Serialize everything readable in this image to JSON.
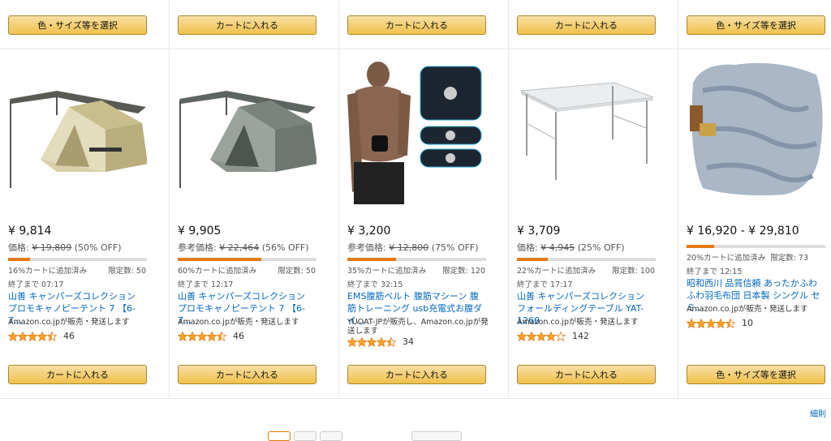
{
  "products": [
    {
      "top_button": "色・サイズ等を選択",
      "price": "¥ 9,814",
      "ref_label": "価格:",
      "ref_price": "¥ 19,809",
      "discount": "(50% OFF)",
      "claimed": "16%カートに追加済み",
      "claimed_pct": 16,
      "limit": "限定数: 50",
      "ends": "終了まで 07:17",
      "title": "山善 キャンパーズコレクション プロモキャノピーテント 7 【6-7...",
      "seller": "Amazon.co.jpが販売・発送します",
      "stars": 4.5,
      "reviews": "46",
      "bottom_button": "カートに入れる",
      "image": "tent-beige-icon"
    },
    {
      "top_button": "カートに入れる",
      "price": "¥ 9,905",
      "ref_label": "参考価格:",
      "ref_price": "¥ 22,464",
      "discount": "(56% OFF)",
      "claimed": "60%カートに追加済み",
      "claimed_pct": 60,
      "limit": "限定数: 50",
      "ends": "終了まで 12:17",
      "title": "山善 キャンパーズコレクション プロモキャノピーテント 7 【6-7...",
      "seller": "Amazon.co.jpが販売・発送します",
      "stars": 4.5,
      "reviews": "46",
      "bottom_button": "カートに入れる",
      "image": "tent-green-icon"
    },
    {
      "top_button": "カートに入れる",
      "price": "¥ 3,200",
      "ref_label": "参考価格:",
      "ref_price": "¥ 12,800",
      "discount": "(75% OFF)",
      "claimed": "35%カートに追加済み",
      "claimed_pct": 35,
      "limit": "限定数: 120",
      "ends": "終了まで 32:15",
      "title": "EMS腹筋ベルト 腹筋マシーン 腹筋トレーニング usb充電式お腹ダイ...",
      "seller": "YUOAT-JPが販売し、Amazon.co.jpが発送します",
      "stars": 4.5,
      "reviews": "34",
      "bottom_button": "カートに入れる",
      "image": "ems-belt-icon"
    },
    {
      "top_button": "カートに入れる",
      "price": "¥ 3,709",
      "ref_label": "価格:",
      "ref_price": "¥ 4,945",
      "discount": "(25% OFF)",
      "claimed": "22%カートに追加済み",
      "claimed_pct": 22,
      "limit": "限定数: 100",
      "ends": "終了まで 17:17",
      "title": "山善 キャンパーズコレクション フォールディングテーブル YAT-1260",
      "seller": "Amazon.co.jpが販売・発送します",
      "stars": 4,
      "reviews": "142",
      "bottom_button": "カートに入れる",
      "image": "folding-table-icon"
    },
    {
      "top_button": "色・サイズ等を選択",
      "price": "¥ 16,920 - ¥ 29,810",
      "claimed": "20%カートに追加済み",
      "claimed_pct": 20,
      "limit": "限定数: 73",
      "ends": "終了まで 12:15",
      "title": "昭和西川 品質信頼 あったかふわふわ羽毛布団 日本製 シングル セミ...",
      "seller": "Amazon.co.jpが販売・発送します",
      "stars": 4.5,
      "reviews": "10",
      "bottom_button": "色・サイズ等を選択",
      "image": "futon-icon"
    }
  ],
  "detail_link": "細則",
  "colors": {
    "accent": "#e47911",
    "link": "#0066c0",
    "star": "#ffa41c"
  }
}
